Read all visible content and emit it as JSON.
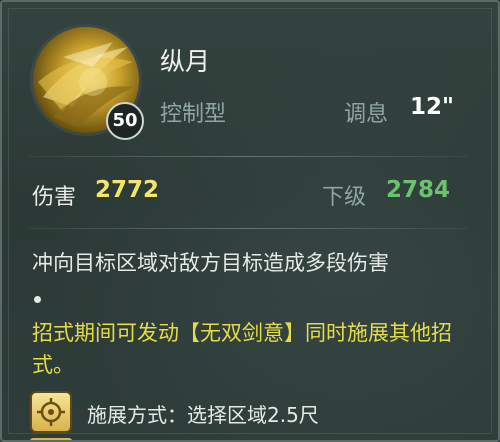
{
  "skill": {
    "name": "纵月",
    "level": "50",
    "type": "控制型",
    "adjust_label": "调息",
    "adjust_value": "12\""
  },
  "stats": {
    "damage_label": "伤害",
    "damage_value": "2772",
    "next_label": "下级",
    "next_value": "2784"
  },
  "description": "冲向目标区域对敌方目标造成多段伤害",
  "note": "招式期间可发动【无双剑意】同时施展其他招式。",
  "cast": {
    "icon": "target-area-icon",
    "text": "施展方式：选择区域2.5尺"
  },
  "colors": {
    "damage": "#f2e66b",
    "next_level": "#6bc36e",
    "note": "#e6dc47",
    "muted": "#8fa6a3"
  }
}
